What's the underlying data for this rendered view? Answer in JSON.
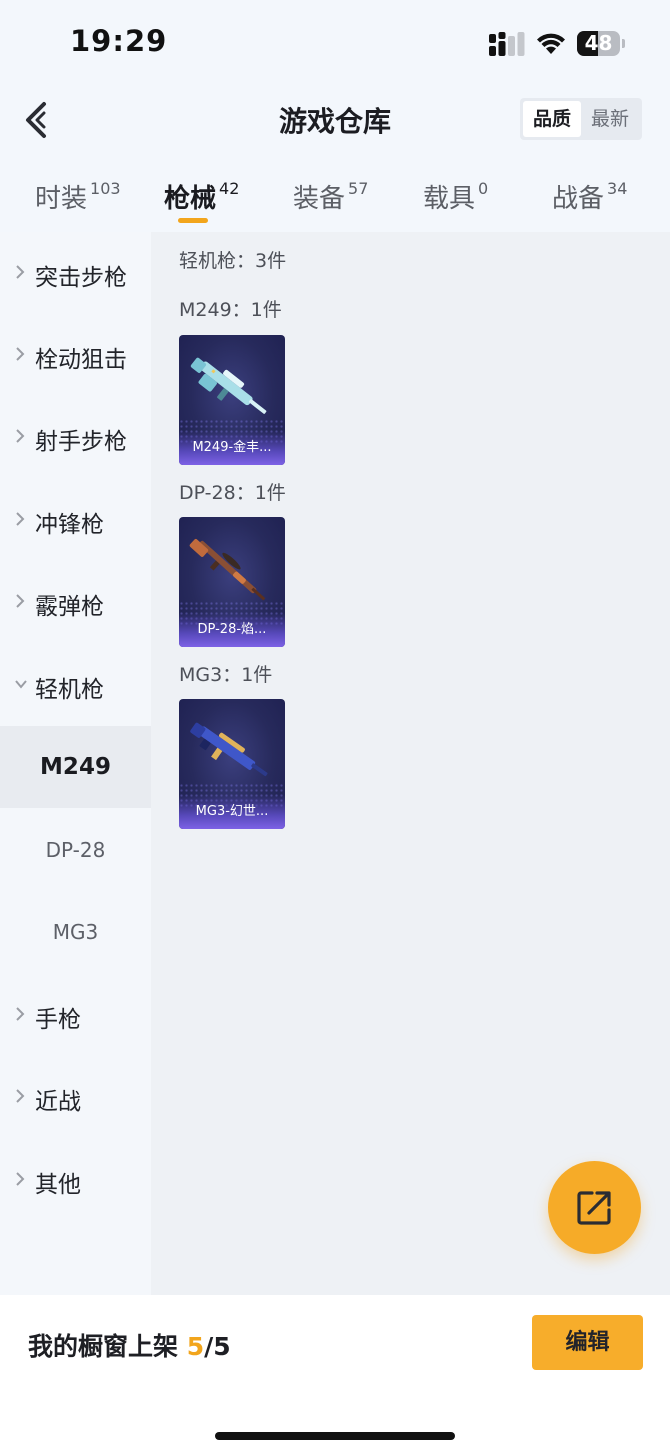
{
  "status_bar": {
    "time": "19:29",
    "battery": "48",
    "battery_level": 0.48
  },
  "header": {
    "title": "游戏仓库",
    "sort_options": [
      "品质",
      "最新"
    ],
    "active_sort": "品质"
  },
  "tabs": [
    {
      "label": "时装",
      "count": "103"
    },
    {
      "label": "枪械",
      "count": "42"
    },
    {
      "label": "装备",
      "count": "57"
    },
    {
      "label": "载具",
      "count": "0"
    },
    {
      "label": "战备",
      "count": "34"
    }
  ],
  "active_tab": "枪械",
  "sidebar": {
    "categories": [
      {
        "label": "突击步枪",
        "expanded": false
      },
      {
        "label": "栓动狙击",
        "expanded": false
      },
      {
        "label": "射手步枪",
        "expanded": false
      },
      {
        "label": "冲锋枪",
        "expanded": false
      },
      {
        "label": "霰弹枪",
        "expanded": false
      },
      {
        "label": "轻机枪",
        "expanded": true
      },
      {
        "label": "手枪",
        "expanded": false
      },
      {
        "label": "近战",
        "expanded": false
      },
      {
        "label": "其他",
        "expanded": false
      }
    ],
    "sub_items": [
      "M249",
      "DP-28",
      "MG3"
    ],
    "active_sub": "M249"
  },
  "content": {
    "category_summary": "轻机枪：3件",
    "groups": [
      {
        "header": "M249：1件",
        "item_name": "M249-金丰...",
        "colors": [
          "#a9dfe8",
          "#79c4d4"
        ]
      },
      {
        "header": "DP-28：1件",
        "item_name": "DP-28-焰...",
        "colors": [
          "#8a4f35",
          "#c06b3d"
        ]
      },
      {
        "header": "MG3：1件",
        "item_name": "MG3-幻世...",
        "colors": [
          "#3f57c9",
          "#e0b35a"
        ]
      }
    ]
  },
  "fab": {
    "icon": "share-external-icon"
  },
  "bottom_bar": {
    "shelf_label": "我的橱窗上架",
    "shelf_current": "5",
    "shelf_total": "/5",
    "edit_label": "编辑"
  },
  "colors": {
    "accent": "#f2a51c",
    "card_bg": "#272a5c",
    "card_label": "#7d62e6"
  }
}
